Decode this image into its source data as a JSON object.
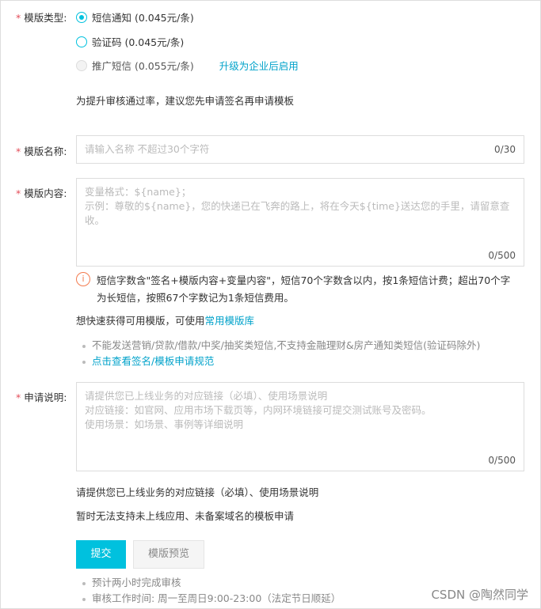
{
  "type": {
    "label": "模版类型:",
    "options": [
      {
        "label": "短信通知 (0.045元/条)",
        "checked": true,
        "disabled": false
      },
      {
        "label": "验证码 (0.045元/条)",
        "checked": false,
        "disabled": false
      },
      {
        "label": "推广短信 (0.055元/条)",
        "checked": false,
        "disabled": true
      }
    ],
    "upgrade_link": "升级为企业后启用",
    "hint": "为提升审核通过率，建议您先申请签名再申请模板"
  },
  "name": {
    "label": "模版名称:",
    "placeholder": "请输入名称 不超过30个字符",
    "counter": "0/30"
  },
  "content": {
    "label": "模版内容:",
    "placeholder": "变量格式：${name}；\n 示例：尊敬的${name}，您的快递已在飞奔的路上，将在今天${time}送达您的手里，请留意查收。",
    "counter": "0/500",
    "warning": "短信字数含\"签名+模版内容+变量内容\"，短信70个字数含以内，按1条短信计费；超出70个字为长短信，按照67个字数记为1条短信费用。",
    "quick_prefix": "想快速获得可用模版，可使用",
    "quick_link": "常用模版库",
    "bullets": [
      "不能发送营销/贷款/借款/中奖/抽奖类短信,不支持金融理财&房产通知类短信(验证码除外)"
    ],
    "bullet_link": "点击查看签名/模板申请规范"
  },
  "apply": {
    "label": "申请说明:",
    "placeholder": "请提供您已上线业务的对应链接（必填）、使用场景说明\n对应链接：如官网、应用市场下载页等，内网环境链接可提交测试账号及密码。\n使用场景：如场景、事例等详细说明",
    "counter": "0/500",
    "note1": "请提供您已上线业务的对应链接（必填）、使用场景说明",
    "note2": "暂时无法支持未上线应用、未备案域名的模板申请"
  },
  "actions": {
    "submit": "提交",
    "preview": "模版预览"
  },
  "footer_bullets": [
    "预计两小时完成审核",
    "审核工作时间: 周一至周日9:00-23:00（法定节日顺延）"
  ],
  "watermark": "CSDN @陶然同学",
  "colors": {
    "accent": "#00c1de",
    "link": "#00a2ca",
    "required": "#e34d59",
    "warning": "#f37b4f"
  },
  "icons": {
    "warning": "info-circle-icon"
  }
}
